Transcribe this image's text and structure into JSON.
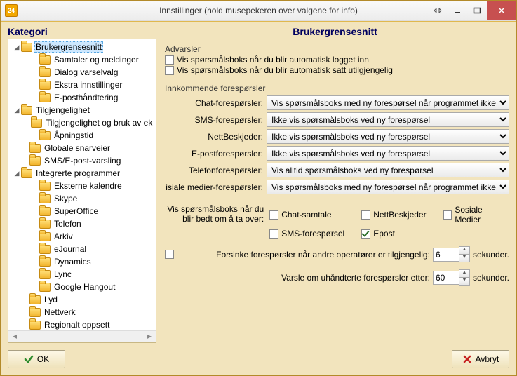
{
  "window": {
    "title": "Innstillinger (hold musepekeren over valgene for info)"
  },
  "headings": {
    "category": "Kategori",
    "panel": "Brukergrensesnitt"
  },
  "tree": {
    "items": [
      {
        "pad": 6,
        "tog": "◢",
        "label": "Brukergrensesnitt",
        "sel": true
      },
      {
        "pad": 32,
        "tog": "",
        "label": "Samtaler og meldinger"
      },
      {
        "pad": 32,
        "tog": "",
        "label": "Dialog varselvalg"
      },
      {
        "pad": 32,
        "tog": "",
        "label": "Ekstra innstillinger"
      },
      {
        "pad": 32,
        "tog": "",
        "label": "E-posthåndtering"
      },
      {
        "pad": 6,
        "tog": "◢",
        "label": "Tilgjengelighet"
      },
      {
        "pad": 32,
        "tog": "",
        "label": "Tilgjengelighet og bruk av ek"
      },
      {
        "pad": 32,
        "tog": "",
        "label": "Åpningstid"
      },
      {
        "pad": 18,
        "tog": "",
        "label": "Globale snarveier"
      },
      {
        "pad": 18,
        "tog": "",
        "label": "SMS/E-post-varsling"
      },
      {
        "pad": 6,
        "tog": "◢",
        "label": "Integrerte programmer"
      },
      {
        "pad": 32,
        "tog": "",
        "label": "Eksterne kalendre"
      },
      {
        "pad": 32,
        "tog": "",
        "label": "Skype"
      },
      {
        "pad": 32,
        "tog": "",
        "label": "SuperOffice"
      },
      {
        "pad": 32,
        "tog": "",
        "label": "Telefon"
      },
      {
        "pad": 32,
        "tog": "",
        "label": "Arkiv"
      },
      {
        "pad": 32,
        "tog": "",
        "label": "eJournal"
      },
      {
        "pad": 32,
        "tog": "",
        "label": "Dynamics"
      },
      {
        "pad": 32,
        "tog": "",
        "label": "Lync"
      },
      {
        "pad": 32,
        "tog": "",
        "label": "Google Hangout"
      },
      {
        "pad": 18,
        "tog": "",
        "label": "Lyd"
      },
      {
        "pad": 18,
        "tog": "",
        "label": "Nettverk"
      },
      {
        "pad": 18,
        "tog": "",
        "label": "Regionalt oppsett"
      }
    ]
  },
  "warnings": {
    "section": "Advarsler",
    "auto_login": "Vis spørsmålsboks når du blir automatisk logget inn",
    "auto_unavail": "Vis spørsmålsboks når du blir automatisk satt utilgjengelig"
  },
  "incoming": {
    "section": "Innkommende forespørsler",
    "rows": [
      {
        "label": "Chat-forespørsler:",
        "value": "Vis spørsmålsboks med ny forespørsel når programmet ikke har fokus"
      },
      {
        "label": "SMS-forespørsler:",
        "value": "Ikke vis spørsmålsboks ved ny forespørsel"
      },
      {
        "label": "NettBeskjeder:",
        "value": "Ikke vis spørsmålsboks ved ny forespørsel"
      },
      {
        "label": "E-postforespørsler:",
        "value": "Ikke vis spørsmålsboks ved ny forespørsel"
      },
      {
        "label": "Telefonforespørsler:",
        "value": "Vis alltid spørsmålsboks ved ny forespørsel"
      },
      {
        "label": "isiale medier-forespørsler:",
        "value": "Vis spørsmålsboks med ny forespørsel når programmet ikke har fokus"
      }
    ]
  },
  "takeover": {
    "lead1": "Vis spørsmålsboks når du",
    "lead2": "blir bedt om å ta over:",
    "opts": [
      {
        "label": "Chat-samtale",
        "checked": false
      },
      {
        "label": "NettBeskjeder",
        "checked": false
      },
      {
        "label": "Sosiale Medier",
        "checked": false
      },
      {
        "label": "SMS-forespørsel",
        "checked": false
      },
      {
        "label": "Epost",
        "checked": true
      }
    ]
  },
  "delay1": {
    "checkbox_label": "Forsinke forespørsler når andre operatører er tilgjengelig:",
    "value": "6",
    "suffix": "sekunder."
  },
  "delay2": {
    "label": "Varsle om uhåndterte forespørsler etter:",
    "value": "60",
    "suffix": "sekunder."
  },
  "buttons": {
    "ok": "OK",
    "cancel": "Avbryt"
  }
}
